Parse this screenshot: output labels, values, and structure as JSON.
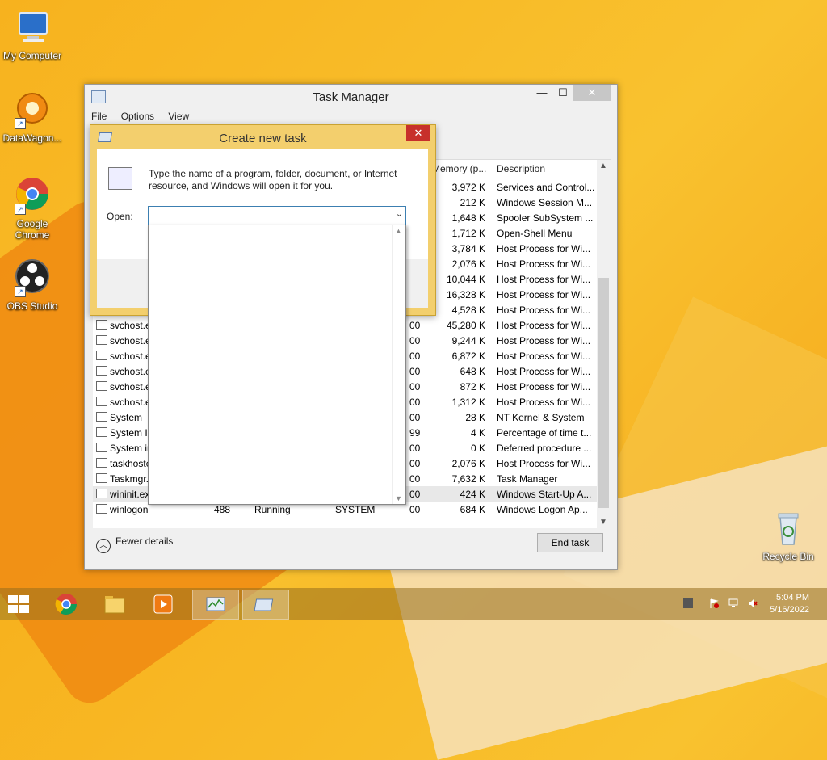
{
  "desktop": {
    "icons": [
      {
        "label": "My Computer",
        "icon": "computer-icon"
      },
      {
        "label": "DataWagon...",
        "icon": "datawagon-icon"
      },
      {
        "label": "Google Chrome",
        "icon": "chrome-icon"
      },
      {
        "label": "OBS Studio",
        "icon": "obs-icon"
      },
      {
        "label": "Recycle Bin",
        "icon": "recycle-bin-icon"
      }
    ]
  },
  "taskmgr": {
    "title": "Task Manager",
    "menu": [
      "File",
      "Options",
      "View"
    ],
    "columns": {
      "memory": "Memory (p...",
      "description": "Description"
    },
    "rows": [
      {
        "memory": "3,972 K",
        "description": "Services and Control..."
      },
      {
        "memory": "212 K",
        "description": "Windows Session M..."
      },
      {
        "memory": "1,648 K",
        "description": "Spooler SubSystem ..."
      },
      {
        "memory": "1,712 K",
        "description": "Open-Shell Menu"
      },
      {
        "memory": "3,784 K",
        "description": "Host Process for Wi..."
      },
      {
        "memory": "2,076 K",
        "description": "Host Process for Wi..."
      },
      {
        "memory": "10,044 K",
        "description": "Host Process for Wi..."
      },
      {
        "memory": "16,328 K",
        "description": "Host Process for Wi..."
      },
      {
        "memory": "4,528 K",
        "description": "Host Process for Wi..."
      },
      {
        "name": "svchost.e",
        "cpu": "00",
        "memory": "45,280 K",
        "description": "Host Process for Wi..."
      },
      {
        "name": "svchost.e",
        "cpu": "00",
        "memory": "9,244 K",
        "description": "Host Process for Wi..."
      },
      {
        "name": "svchost.e",
        "cpu": "00",
        "memory": "6,872 K",
        "description": "Host Process for Wi..."
      },
      {
        "name": "svchost.e",
        "cpu": "00",
        "memory": "648 K",
        "description": "Host Process for Wi..."
      },
      {
        "name": "svchost.e",
        "cpu": "00",
        "memory": "872 K",
        "description": "Host Process for Wi..."
      },
      {
        "name": "svchost.e",
        "cpu": "00",
        "memory": "1,312 K",
        "description": "Host Process for Wi..."
      },
      {
        "name": "System",
        "cpu": "00",
        "memory": "28 K",
        "description": "NT Kernel & System"
      },
      {
        "name": "System Ic",
        "cpu": "99",
        "memory": "4 K",
        "description": "Percentage of time t..."
      },
      {
        "name": "System in",
        "cpu": "00",
        "memory": "0 K",
        "description": "Deferred procedure ..."
      },
      {
        "name": "taskhoste",
        "cpu": "00",
        "memory": "2,076 K",
        "description": "Host Process for Wi..."
      },
      {
        "name": "Taskmgr.",
        "cpu": "00",
        "memory": "7,632 K",
        "description": "Task Manager"
      },
      {
        "name": "wininit.ex",
        "cpu": "00",
        "memory": "424 K",
        "description": "Windows Start-Up A..."
      },
      {
        "name": "winlogon.exe",
        "pid": "488",
        "status": "Running",
        "user": "SYSTEM",
        "cpu": "00",
        "memory": "684 K",
        "description": "Windows Logon Ap..."
      }
    ],
    "fewer_details": "Fewer details",
    "end_task": "End task"
  },
  "dialog": {
    "title": "Create new task",
    "message": "Type the name of a program, folder, document, or Internet resource, and Windows will open it for you.",
    "open_label": "Open:",
    "open_value": ""
  },
  "taskbar": {
    "apps": [
      "start-icon",
      "chrome-icon",
      "file-explorer-icon",
      "media-player-icon",
      "task-manager-icon",
      "run-dialog-icon"
    ],
    "time": "5:04 PM",
    "date": "5/16/2022"
  }
}
